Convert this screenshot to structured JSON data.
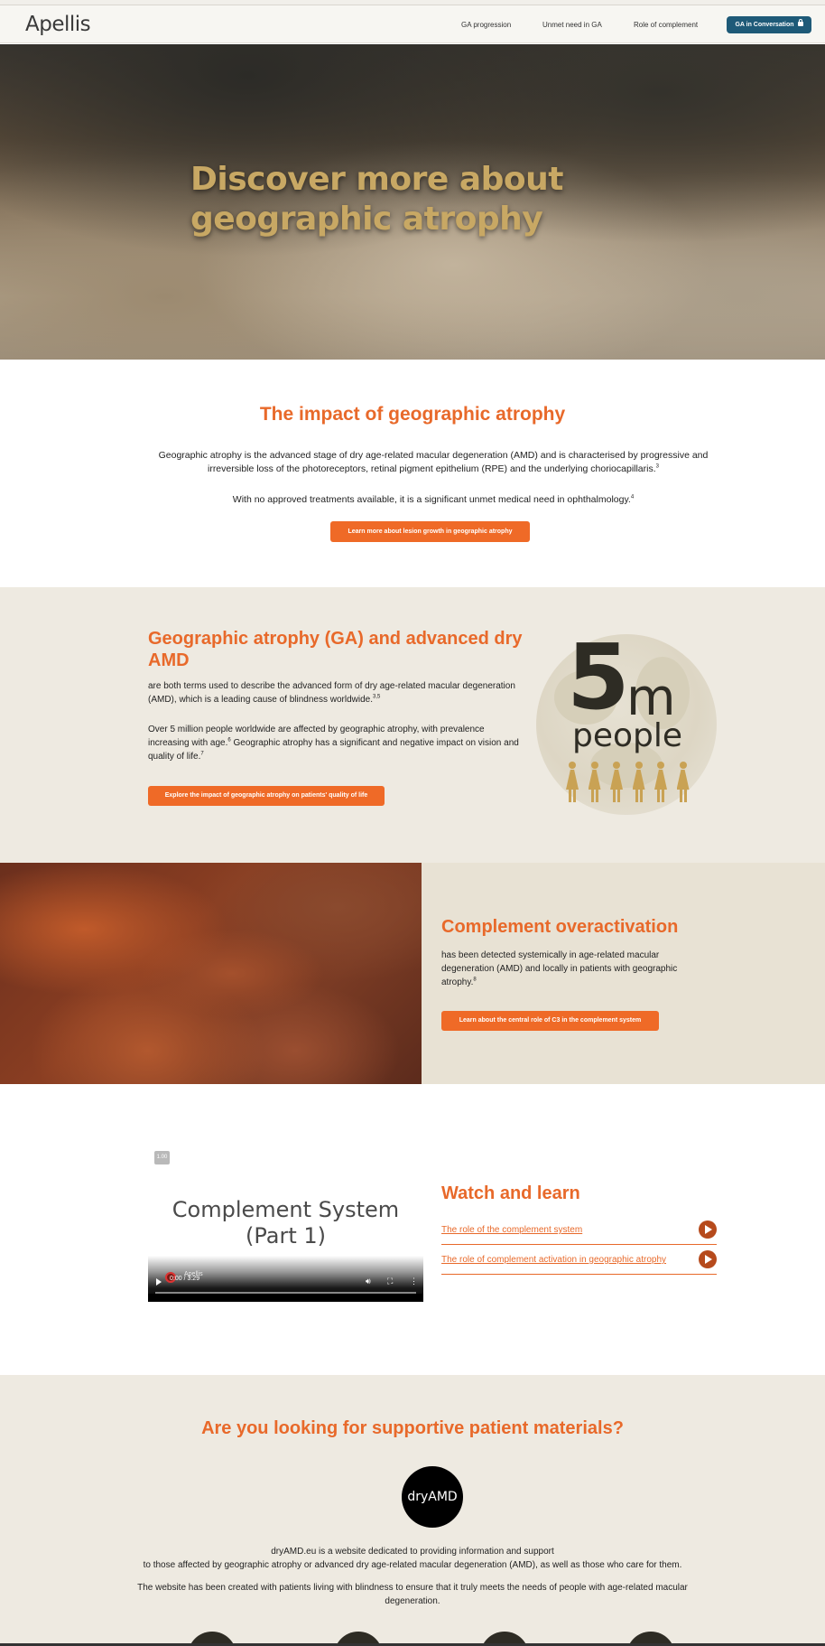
{
  "header": {
    "logo": "Apellis",
    "nav": [
      "GA progression",
      "Unmet need in GA",
      "Role of complement"
    ],
    "cta": "GA in Conversation",
    "cta_icon": "lock-icon"
  },
  "hero": {
    "title": "Discover more about geographic atrophy"
  },
  "impact": {
    "title": "The impact of geographic atrophy",
    "p1": "Geographic atrophy is the advanced stage of dry age-related macular degeneration (AMD) and is characterised by progressive and irreversible loss of the photoreceptors, retinal pigment epithelium (RPE) and the underlying choriocapillaris.",
    "p1_sup": "3",
    "p2": "With no approved treatments available, it is a significant unmet medical need in ophthalmology.",
    "p2_sup": "4",
    "button": "Learn more about lesion growth in geographic atrophy"
  },
  "ga": {
    "title": "Geographic atrophy (GA) and advanced dry AMD",
    "p1": "are both terms used to describe the advanced form of dry age-related macular degeneration (AMD), which is a leading cause of blindness worldwide.",
    "p1_sup": "3,5",
    "p2a": "Over 5 million people worldwide are affected by geographic atrophy, with prevalence increasing with age.",
    "p2a_sup": "6",
    "p2b": " Geographic atrophy has a significant and negative impact on vision and quality of life.",
    "p2b_sup": "7",
    "button": "Explore the impact of geographic atrophy on patients' quality of life",
    "stat_number": "5",
    "stat_unit": "m",
    "stat_label": "people",
    "people_count": 6
  },
  "complement": {
    "title": "Complement overactivation",
    "p": "has been detected systemically in age-related macular degeneration (AMD) and locally in patients with geographic atrophy.",
    "p_sup": "8",
    "button": "Learn about the central role of C3 in the complement system"
  },
  "video": {
    "speed": "1.00",
    "title": "Complement System (Part 1)",
    "brand": "Apellis",
    "time": "0:00 / 3:29"
  },
  "watch": {
    "title": "Watch and learn",
    "items": [
      "The role of the complement system",
      "The role of complement activation in geographic atrophy"
    ]
  },
  "materials": {
    "title": "Are you looking for supportive patient materials?",
    "logo": "dryAMD",
    "p1a": "dryAMD.eu is a website dedicated to providing information and support",
    "p1b": "to those affected by geographic atrophy or advanced dry age-related macular degeneration (AMD), as well as those who care for them.",
    "p2": "The website has been created with patients living with blindness to ensure that it truly meets the needs of people with age-related macular degeneration."
  },
  "colors": {
    "accent": "#e8692a",
    "button": "#ef6a27",
    "cta": "#1e5a78",
    "beige": "#eeeae1",
    "gold": "#c9a254"
  }
}
